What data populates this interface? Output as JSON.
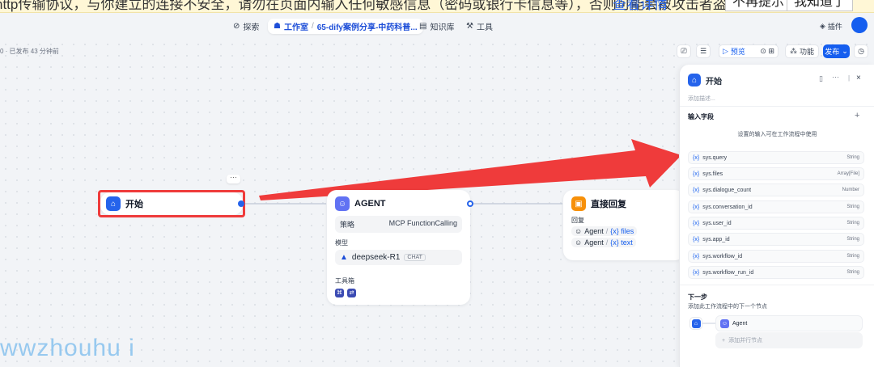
{
  "banner": {
    "text": "http传输协议，与你建立的连接不安全，请勿在页面内输入任何敏感信息（密码或银行卡信息等），否则可能会被攻击者盗用",
    "link": "查看详情",
    "btn_no_remind": "不再提示",
    "btn_ok": "我知道了"
  },
  "topnav": {
    "explore": "探索",
    "studio": "工作室",
    "app_name": "65-dify案例分享-中药科普...",
    "knowledge": "知识库",
    "tools": "工具",
    "plugins": "插件"
  },
  "status": "0 · 已发布 43 分钟前",
  "toolbar": {
    "preview": "预览",
    "features": "功能",
    "publish": "发布"
  },
  "nodes": {
    "start": {
      "title": "开始",
      "more": "···"
    },
    "agent": {
      "title": "AGENT",
      "strategy_label": "策略",
      "strategy_value": "MCP FunctionCalling",
      "model_label": "模型",
      "model_name": "deepseek-R1",
      "model_badge": "CHAT",
      "tools_label": "工具箱"
    },
    "answer": {
      "title": "直接回复",
      "reply_label": "回复",
      "refs": [
        {
          "node": "Agent",
          "var": "{x} files"
        },
        {
          "node": "Agent",
          "var": "{x} text"
        }
      ]
    }
  },
  "panel": {
    "title": "开始",
    "desc_placeholder": "添加描述...",
    "input_section": "输入字段",
    "input_hint": "设置的输入可在工作流程中使用",
    "variables": [
      {
        "name": "sys.query",
        "type": "String"
      },
      {
        "name": "sys.files",
        "type": "Array[File]"
      },
      {
        "name": "sys.dialogue_count",
        "type": "Number"
      },
      {
        "name": "sys.conversation_id",
        "type": "String"
      },
      {
        "name": "sys.user_id",
        "type": "String"
      },
      {
        "name": "sys.app_id",
        "type": "String"
      },
      {
        "name": "sys.workflow_id",
        "type": "String"
      },
      {
        "name": "sys.workflow_run_id",
        "type": "String"
      }
    ],
    "var_prefix": "{x}",
    "next_section": "下一步",
    "next_hint": "添加此工作流程中的下一个节点",
    "next_node": "Agent",
    "add_parallel": "添加并行节点"
  },
  "watermark": "wwzhouhu i",
  "colors": {
    "accent": "#155eef",
    "highlight": "#ef3b3b",
    "start_icon": "#2563eb",
    "agent_icon": "#6172f3",
    "answer_icon": "#f79009"
  }
}
